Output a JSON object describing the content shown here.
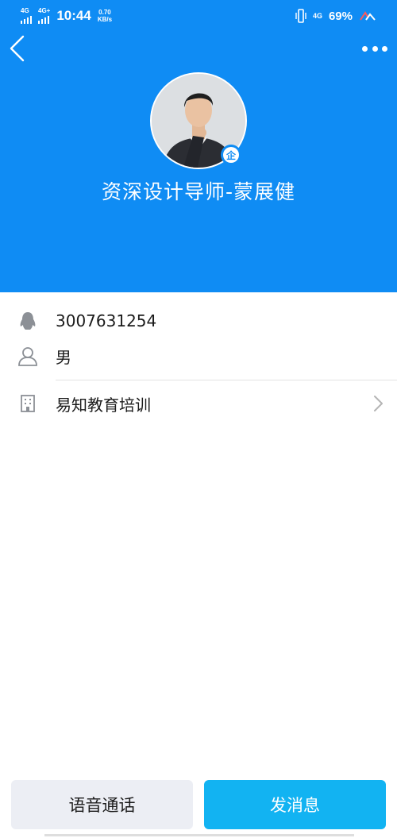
{
  "status_bar": {
    "network_1": "4G",
    "network_2": "4G+",
    "time": "10:44",
    "speed_value": "0.70",
    "speed_unit": "KB/s",
    "network_right": "4G",
    "battery": "69%",
    "icons": [
      "signal-bars-icon",
      "vibrate-icon",
      "hd-icon"
    ]
  },
  "nav": {
    "back_icon": "chevron-left-icon",
    "more_icon": "more-dots-icon"
  },
  "profile": {
    "name": "资深设计导师-蒙展健",
    "badge": "企",
    "avatar": "avatar-photo"
  },
  "info": {
    "qq_number": "3007631254",
    "gender": "男",
    "company": "易知教育培训"
  },
  "actions": {
    "voice_call": "语音通话",
    "send_message": "发消息"
  },
  "colors": {
    "header_bg": "#0f8cf4",
    "primary_button": "#12b3f2",
    "secondary_button": "#eceef4"
  }
}
